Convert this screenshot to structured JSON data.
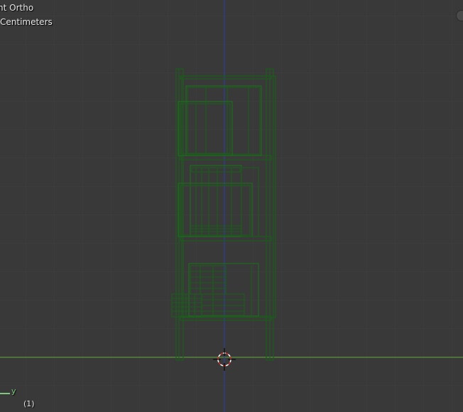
{
  "viewport": {
    "view_name": "ht Ortho",
    "units": "Centimeters",
    "frame_number": "(1)",
    "axis_label_y": "y"
  },
  "colors": {
    "background": "#393939",
    "grid": "#414141",
    "x_axis_line": "#5ea836",
    "z_axis_line": "#2d3ea8",
    "wireframe": "#1c5c1c",
    "text": "#e6e6e6"
  },
  "icons": {
    "cursor": "3d-cursor-icon",
    "navigation": "navigation-gizmo-icon",
    "axis": "axis-indicator-icon"
  }
}
